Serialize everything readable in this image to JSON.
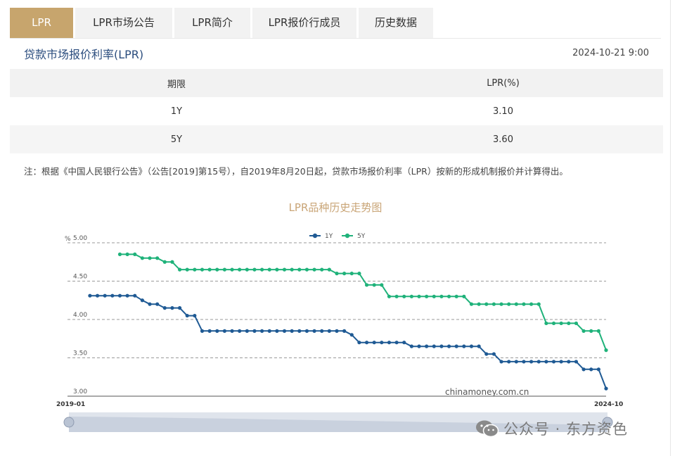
{
  "tabs": [
    {
      "label": "LPR",
      "active": true
    },
    {
      "label": "LPR市场公告",
      "active": false
    },
    {
      "label": "LPR简介",
      "active": false
    },
    {
      "label": "LPR报价行成员",
      "active": false
    },
    {
      "label": "历史数据",
      "active": false
    }
  ],
  "section": {
    "title": "贷款市场报价利率(LPR)",
    "timestamp": "2024-10-21 9:00"
  },
  "table": {
    "headers": [
      "期限",
      "LPR(%)"
    ],
    "rows": [
      [
        "1Y",
        "3.10"
      ],
      [
        "5Y",
        "3.60"
      ]
    ]
  },
  "note": "注：根据《中国人民银行公告》（公告[2019]第15号），自2019年8月20日起，贷款市场报价利率（LPR）按新的形成机制报价并计算得出。",
  "chart_data": {
    "type": "line",
    "title": "LPR品种历史走势图",
    "ylabel": "%",
    "ylim": [
      3.0,
      5.0
    ],
    "yticks": [
      "5.00",
      "4.50",
      "4.00",
      "3.50",
      "3.00"
    ],
    "x_start_label": "2019-01",
    "x_end_label": "2024-10",
    "legend": "top-center",
    "grid": true,
    "series": [
      {
        "name": "1Y",
        "color": "#1f5a94",
        "values": [
          4.31,
          4.31,
          4.31,
          4.31,
          4.31,
          4.31,
          4.31,
          4.25,
          4.2,
          4.2,
          4.15,
          4.15,
          4.15,
          4.05,
          4.05,
          3.85,
          3.85,
          3.85,
          3.85,
          3.85,
          3.85,
          3.85,
          3.85,
          3.85,
          3.85,
          3.85,
          3.85,
          3.85,
          3.85,
          3.85,
          3.85,
          3.85,
          3.85,
          3.85,
          3.85,
          3.8,
          3.7,
          3.7,
          3.7,
          3.7,
          3.7,
          3.7,
          3.7,
          3.65,
          3.65,
          3.65,
          3.65,
          3.65,
          3.65,
          3.65,
          3.65,
          3.65,
          3.65,
          3.55,
          3.55,
          3.45,
          3.45,
          3.45,
          3.45,
          3.45,
          3.45,
          3.45,
          3.45,
          3.45,
          3.45,
          3.45,
          3.35,
          3.35,
          3.35,
          3.1
        ]
      },
      {
        "name": "5Y",
        "color": "#1fb27a",
        "values": [
          null,
          null,
          null,
          null,
          null,
          null,
          null,
          4.85,
          4.85,
          4.85,
          4.8,
          4.8,
          4.8,
          4.75,
          4.75,
          4.65,
          4.65,
          4.65,
          4.65,
          4.65,
          4.65,
          4.65,
          4.65,
          4.65,
          4.65,
          4.65,
          4.65,
          4.65,
          4.65,
          4.65,
          4.65,
          4.65,
          4.65,
          4.65,
          4.65,
          4.65,
          4.6,
          4.6,
          4.6,
          4.6,
          4.45,
          4.45,
          4.45,
          4.3,
          4.3,
          4.3,
          4.3,
          4.3,
          4.3,
          4.3,
          4.3,
          4.3,
          4.3,
          4.3,
          4.2,
          4.2,
          4.2,
          4.2,
          4.2,
          4.2,
          4.2,
          4.2,
          4.2,
          4.2,
          3.95,
          3.95,
          3.95,
          3.95,
          3.95,
          3.85,
          3.85,
          3.85,
          3.6
        ]
      }
    ],
    "source_label": "chinamoney.com.cn"
  },
  "watermark": {
    "text": "公众号 · 东方资色",
    "icon": "wechat-icon"
  }
}
